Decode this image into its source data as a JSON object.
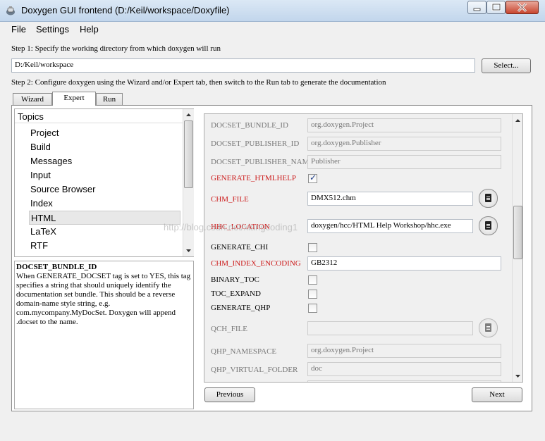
{
  "window": {
    "title": "Doxygen GUI frontend (D:/Keil/workspace/Doxyfile)",
    "icon": "doxygen-app-icon"
  },
  "menu": [
    "File",
    "Settings",
    "Help"
  ],
  "step1": {
    "label": "Step 1: Specify the working directory from which doxygen will run",
    "workdir": "D:/Keil/workspace",
    "select_label": "Select..."
  },
  "step2": {
    "label": "Step 2: Configure doxygen using the Wizard and/or Expert tab, then switch to the Run tab to generate the documentation"
  },
  "tabs": [
    "Wizard",
    "Expert",
    "Run"
  ],
  "active_tab": "Expert",
  "topics": {
    "header": "Topics",
    "items": [
      "Project",
      "Build",
      "Messages",
      "Input",
      "Source Browser",
      "Index",
      "HTML",
      "LaTeX",
      "RTF"
    ],
    "selected": "HTML"
  },
  "help": {
    "title": "DOCSET_BUNDLE_ID",
    "text": "When GENERATE_DOCSET tag is set to YES, this tag specifies a string that should uniquely identify the documentation set bundle. This should be a reverse domain-name style string, e.g. com.mycompany.MyDocSet. Doxygen will append .docset to the name."
  },
  "options": [
    {
      "name": "DOCSET_BUNDLE_ID",
      "value": "org.doxygen.Project"
    },
    {
      "name": "DOCSET_PUBLISHER_ID",
      "value": "org.doxygen.Publisher"
    },
    {
      "name": "DOCSET_PUBLISHER_NAME",
      "value": "Publisher"
    },
    {
      "name": "GENERATE_HTMLHELP",
      "checked": true
    },
    {
      "name": "CHM_FILE",
      "value": "DMX512.chm"
    },
    {
      "name": "HHC_LOCATION",
      "value": "doxygen/hcc/HTML Help Workshop/hhc.exe"
    },
    {
      "name": "GENERATE_CHI",
      "checked": false
    },
    {
      "name": "CHM_INDEX_ENCODING",
      "value": "GB2312"
    },
    {
      "name": "BINARY_TOC",
      "checked": false
    },
    {
      "name": "TOC_EXPAND",
      "checked": false
    },
    {
      "name": "GENERATE_QHP",
      "checked": false
    },
    {
      "name": "QCH_FILE",
      "value": ""
    },
    {
      "name": "QHP_NAMESPACE",
      "value": "org.doxygen.Project"
    },
    {
      "name": "QHP_VIRTUAL_FOLDER",
      "value": "doc"
    }
  ],
  "buttons": {
    "previous": "Previous",
    "next": "Next"
  },
  "watermark": "http://blog.csdn.net/xiangcoding1"
}
